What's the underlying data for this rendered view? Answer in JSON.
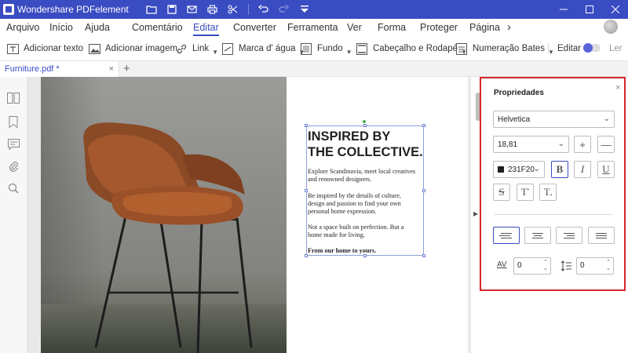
{
  "titlebar": {
    "title": "Wondershare PDFelement"
  },
  "menu": {
    "items": [
      "Arquivo",
      "Início",
      "Ajuda",
      "Comentário",
      "Editar",
      "Converter",
      "Ferramenta",
      "Ver",
      "Forma",
      "Proteger",
      "Página"
    ],
    "active": "Editar",
    "more": "›"
  },
  "toolbar": {
    "add_text": "Adicionar texto",
    "add_image": "Adicionar imagem",
    "link": "Link",
    "watermark": "Marca d' água",
    "background": "Fundo",
    "header_footer": "Cabeçalho e Rodapé",
    "bates": "Numeração Bates",
    "edit": "Editar",
    "read": "Ler",
    "edit_toggle_on": true
  },
  "tabs": {
    "file": "Furniture.pdf *",
    "close": "×",
    "add": "+"
  },
  "document": {
    "heading_line1": "INSPIRED BY",
    "heading_line2": "THE COLLECTIVE.",
    "para1_l1": "Explore Scandinavia, meet local creatives",
    "para1_l2": "and renowned designers.",
    "para2_l1": "Be inspired by the details of culture,",
    "para2_l2": "design and passion to find your own",
    "para2_l3": "personal home expression.",
    "para3_l1": "Not a space built on perfection. But a",
    "para3_l2": "home made for living.",
    "para4": "From our home to yours."
  },
  "properties": {
    "title": "Propriedades",
    "close": "×",
    "font": "Helvetica",
    "size": "18,81",
    "color": "231F20",
    "color_hex": "#231f20",
    "plus": "+",
    "minus": "—",
    "bold": "B",
    "italic": "I",
    "underline": "U",
    "strike": "S",
    "superscript": "T",
    "subscript": "T",
    "char_spacing": "0",
    "line_spacing": "0",
    "char_spacing_icon": "AV",
    "alignment": "left"
  },
  "accent_color": "#3a4cc2",
  "highlight_color": "#d9252b"
}
